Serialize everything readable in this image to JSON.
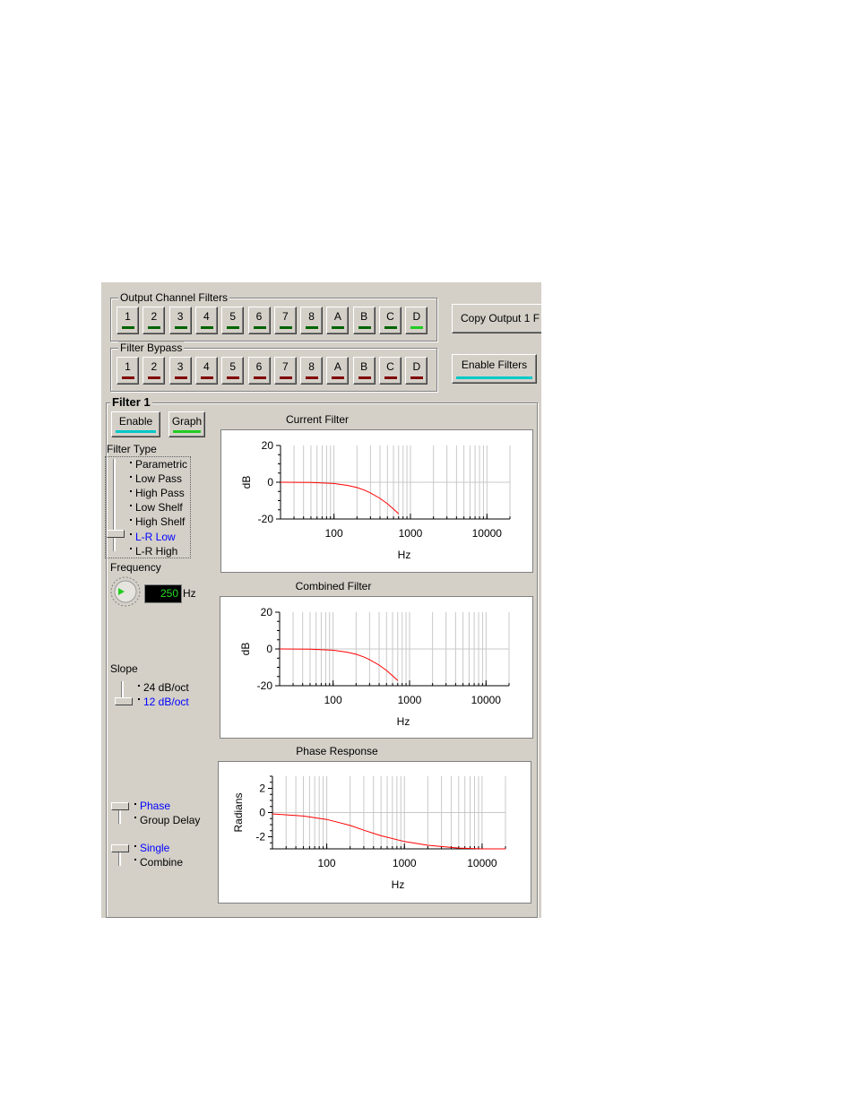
{
  "output_channel_filters": {
    "label": "Output Channel Filters",
    "buttons": [
      "1",
      "2",
      "3",
      "4",
      "5",
      "6",
      "7",
      "8",
      "A",
      "B",
      "C",
      "D"
    ],
    "indicator_colors": [
      "#006400",
      "#006400",
      "#006400",
      "#006400",
      "#006400",
      "#006400",
      "#006400",
      "#006400",
      "#006400",
      "#006400",
      "#006400",
      "#22cc22"
    ]
  },
  "filter_bypass": {
    "label": "Filter Bypass",
    "buttons": [
      "1",
      "2",
      "3",
      "4",
      "5",
      "6",
      "7",
      "8",
      "A",
      "B",
      "C",
      "D"
    ],
    "indicator_color": "#800000"
  },
  "copy_output_label": "Copy Output 1 F",
  "enable_filters_label": "Enable Filters",
  "enable_filters_indicator": "#00c8c8",
  "filter": {
    "title": "Filter 1",
    "enable_label": "Enable",
    "enable_indicator": "#00c8c8",
    "graph_label": "Graph",
    "graph_indicator": "#22cc22",
    "filter_type_label": "Filter Type",
    "filter_types": [
      "Parametric",
      "Low Pass",
      "High Pass",
      "Low Shelf",
      "High Shelf",
      "L-R Low",
      "L-R High"
    ],
    "selected_type": "L-R Low",
    "frequency_label": "Frequency",
    "frequency_value": "250",
    "frequency_unit": "Hz",
    "slope_label": "Slope",
    "slope_options": [
      "24 dB/oct",
      "12 dB/oct"
    ],
    "selected_slope": "12 dB/oct",
    "display_options": [
      "Phase",
      "Group Delay"
    ],
    "selected_display": "Phase",
    "mode_options": [
      "Single",
      "Combine"
    ],
    "selected_mode": "Single"
  },
  "selected_color": "#0000ff",
  "chart_data": [
    {
      "type": "line",
      "title": "Current Filter",
      "xlabel": "Hz",
      "ylabel": "dB",
      "x_scale": "log",
      "xlim": [
        20,
        20000
      ],
      "ylim": [
        -20,
        20
      ],
      "xticks": [
        "100",
        "1000",
        "10000"
      ],
      "yticks": [
        "20",
        "0",
        "-20"
      ],
      "grid": true,
      "series": [
        {
          "color": "#ff0000",
          "x": [
            20,
            50,
            100,
            150,
            200,
            250,
            300,
            400,
            500,
            600,
            700
          ],
          "y": [
            0,
            -0.1,
            -0.7,
            -1.7,
            -2.9,
            -4.3,
            -5.8,
            -8.8,
            -11.7,
            -14.6,
            -17.2
          ]
        }
      ]
    },
    {
      "type": "line",
      "title": "Combined Filter",
      "xlabel": "Hz",
      "ylabel": "dB",
      "x_scale": "log",
      "xlim": [
        20,
        20000
      ],
      "ylim": [
        -20,
        20
      ],
      "xticks": [
        "100",
        "1000",
        "10000"
      ],
      "yticks": [
        "20",
        "0",
        "-20"
      ],
      "grid": true,
      "series": [
        {
          "color": "#ff0000",
          "x": [
            20,
            50,
            100,
            150,
            200,
            250,
            300,
            400,
            500,
            600,
            700
          ],
          "y": [
            0,
            -0.1,
            -0.7,
            -1.7,
            -2.9,
            -4.3,
            -5.8,
            -8.8,
            -11.7,
            -14.6,
            -17.2
          ]
        }
      ]
    },
    {
      "type": "line",
      "title": "Phase Response",
      "xlabel": "Hz",
      "ylabel": "Radians",
      "x_scale": "log",
      "xlim": [
        20,
        20000
      ],
      "ylim": [
        -3,
        3
      ],
      "xticks": [
        "100",
        "1000",
        "10000"
      ],
      "yticks": [
        "2",
        "0",
        "-2"
      ],
      "grid": true,
      "series": [
        {
          "color": "#ff0000",
          "x": [
            20,
            50,
            100,
            200,
            300,
            500,
            1000,
            2000,
            5000,
            10000,
            20000
          ],
          "y": [
            -0.11,
            -0.29,
            -0.57,
            -1.07,
            -1.46,
            -1.92,
            -2.39,
            -2.7,
            -2.93,
            -3.0,
            -3.1
          ]
        }
      ]
    }
  ]
}
